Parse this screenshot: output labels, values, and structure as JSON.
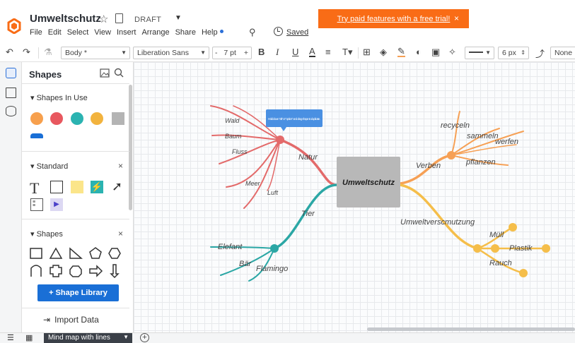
{
  "header": {
    "title": "Umweltschutz",
    "draft": "DRAFT",
    "menu": [
      "File",
      "Edit",
      "Select",
      "View",
      "Insert",
      "Arrange",
      "Share",
      "Help"
    ],
    "saved": "Saved",
    "promo": "Try paid features with a free trial!",
    "promo_close": "×"
  },
  "toolbar": {
    "style_select": "Body *",
    "font_select": "Liberation Sans",
    "font_size": "7 pt",
    "minus": "-",
    "plus": "+",
    "bold": "B",
    "italic": "I",
    "underline": "U",
    "text_color": "A",
    "line_width": "6 px",
    "arrow_none": "None"
  },
  "panel": {
    "title": "Shapes",
    "sections": {
      "in_use": "Shapes In Use",
      "standard": "Standard",
      "shapes": "Shapes"
    },
    "close": "×",
    "in_use_colors": [
      "#f7a04d",
      "#e8585f",
      "#2bb3b1",
      "#f2b33e",
      "#b4b4b4"
    ],
    "library_button": "+ Shape Library",
    "import_button": "Import Data"
  },
  "canvas": {
    "tooltip": "Hold down \"alt\" or \"option\" and drag shape to duplicate.",
    "central": "Umweltschutz",
    "branches": {
      "natur": "Natur",
      "tier": "Tier",
      "verben": "Verben",
      "verschmutzung": "Umweltverscmutzung"
    },
    "leaves": {
      "wald": "Wald",
      "baum": "Baum",
      "fluss": "Fluss",
      "meer": "Meer",
      "luft": "Luft",
      "elefant": "Elefant",
      "baer": "Bär",
      "flamingo": "Flamingo",
      "recyceln": "recyceln",
      "sammeln": "sammeln",
      "werfen": "werfen",
      "pflanzen": "pflanzen",
      "muell": "Müll",
      "plastik": "Plastik",
      "rauch": "Rauch"
    },
    "colors": {
      "red": "#e36a6a",
      "teal": "#2ba7a5",
      "orange": "#f6a055",
      "yellow": "#f5be4a",
      "central_fill": "#b8b8b8"
    }
  },
  "bottom": {
    "page_tab": "Mind map with lines"
  }
}
